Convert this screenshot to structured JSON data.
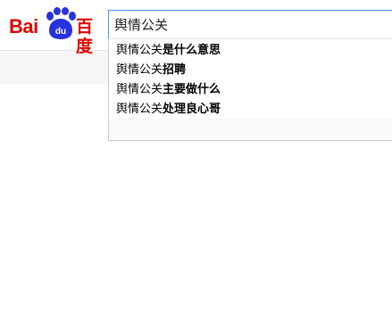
{
  "logo": {
    "text_latin": "Bai",
    "text_du": "du",
    "text_cn": "百度",
    "brand_red": "#e10601",
    "brand_blue": "#2932e1"
  },
  "search": {
    "value": "舆情公关"
  },
  "suggestions": [
    {
      "query": "舆情公关",
      "rest": "是什么意思"
    },
    {
      "query": "舆情公关",
      "rest": "招聘"
    },
    {
      "query": "舆情公关",
      "rest": "主要做什么"
    },
    {
      "query": "舆情公关",
      "rest": "处理良心哥"
    }
  ]
}
